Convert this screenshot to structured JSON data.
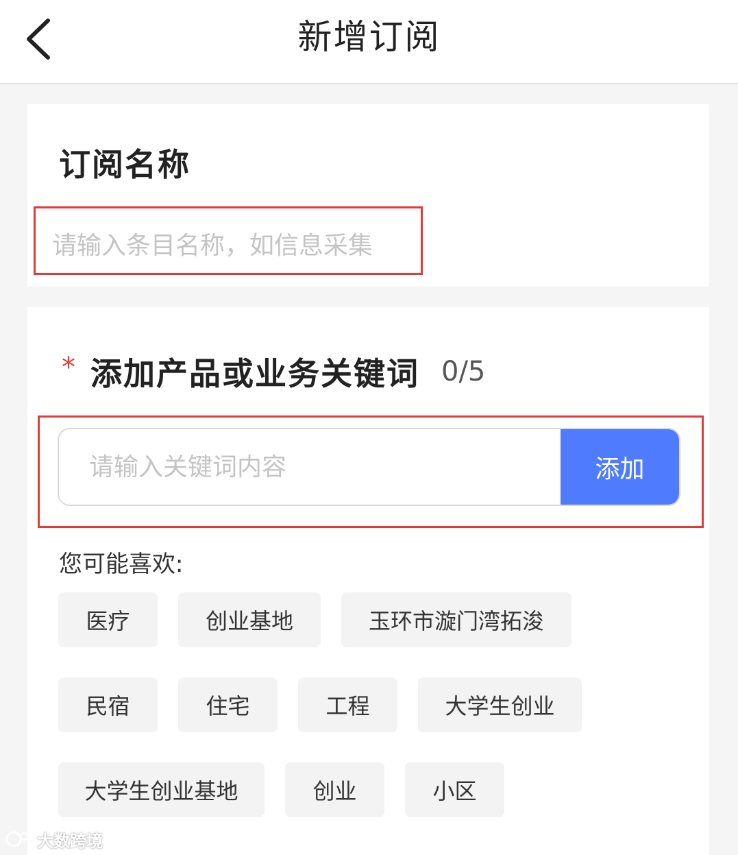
{
  "header": {
    "title": "新增订阅"
  },
  "subscription_name": {
    "label": "订阅名称",
    "placeholder": "请输入条目名称，如信息采集",
    "value": ""
  },
  "keywords": {
    "required_mark": "*",
    "label": "添加产品或业务关键词",
    "count": "0/5",
    "input_placeholder": "请输入关键词内容",
    "input_value": "",
    "add_button_label": "添加"
  },
  "suggestions": {
    "label": "您可能喜欢:",
    "tags": [
      "医疗",
      "创业基地",
      "玉环市漩门湾拓浚",
      "民宿",
      "住宅",
      "工程",
      "大学生创业",
      "大学生创业基地",
      "创业",
      "小区"
    ]
  },
  "colors": {
    "accent": "#4f7bff",
    "highlight": "#e53935",
    "required": "#e53935"
  },
  "watermark": {
    "text": "大数跨境"
  }
}
